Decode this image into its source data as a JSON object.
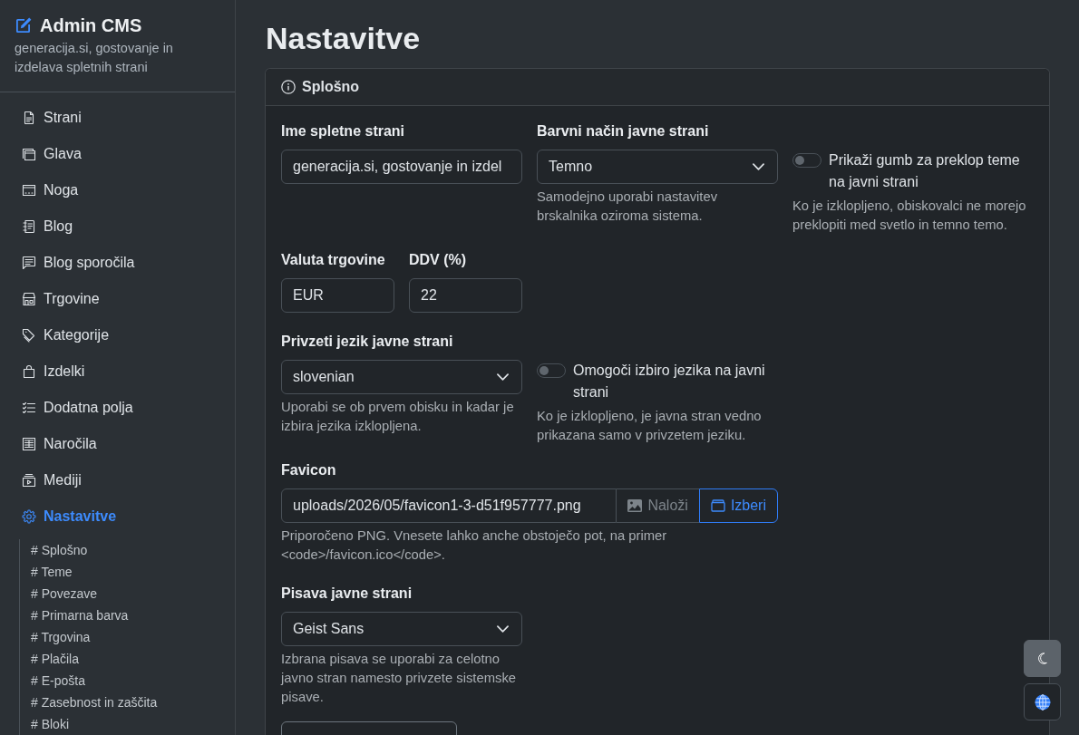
{
  "sidebar": {
    "brand": "Admin CMS",
    "tagline": "generacija.si, gostovanje in izdelava spletnih strani",
    "items": [
      {
        "label": "Strani",
        "selected": false
      },
      {
        "label": "Glava",
        "selected": false
      },
      {
        "label": "Noga",
        "selected": false
      },
      {
        "label": "Blog",
        "selected": false
      },
      {
        "label": "Blog sporočila",
        "selected": false
      },
      {
        "label": "Trgovine",
        "selected": false
      },
      {
        "label": "Kategorije",
        "selected": false
      },
      {
        "label": "Izdelki",
        "selected": false
      },
      {
        "label": "Dodatna polja",
        "selected": false
      },
      {
        "label": "Naročila",
        "selected": false
      },
      {
        "label": "Mediji",
        "selected": false
      },
      {
        "label": "Nastavitve",
        "selected": true,
        "children": [
          {
            "label": "# Splošno"
          },
          {
            "label": "# Teme"
          },
          {
            "label": "# Povezave"
          },
          {
            "label": "# Primarna barva"
          },
          {
            "label": "# Trgovina"
          },
          {
            "label": "# Plačila"
          },
          {
            "label": "# E-pošta"
          },
          {
            "label": "# Zasebnost in zaščita"
          },
          {
            "label": "# Bloki"
          }
        ]
      }
    ]
  },
  "page": {
    "title": "Nastavitve"
  },
  "card": {
    "title": "Splošno",
    "rows": [
      {
        "fields": [
          {
            "kind": "text",
            "label": "Ime spletne strani",
            "value": "generacija.si, gostovanje in izdel"
          },
          {
            "kind": "select",
            "label": "Barvni način javne strani",
            "value": "Temno",
            "help": "Samodejno uporabi nastavitev brskalnika oziroma sistema."
          },
          {
            "kind": "toggle",
            "label": "Prikaži gumb za preklop teme na javni strani",
            "on": false,
            "help": "Ko je izklopljeno, obiskovalci ne morejo preklopiti med svetlo in temno temo."
          }
        ]
      },
      {
        "fields": [
          {
            "kind": "short_text",
            "label": "Valuta trgovine",
            "value": "EUR"
          },
          {
            "kind": "short_text",
            "label": "DDV (%)",
            "value": "22"
          }
        ]
      },
      {
        "fields": [
          {
            "kind": "select",
            "label": "Privzeti jezik javne strani",
            "value": "slovenian",
            "help": "Uporabi se ob prvem obisku in kadar je izbira jezika izklopljena."
          },
          {
            "kind": "toggle",
            "label": "Omogoči izbiro jezika na javni strani",
            "on": false,
            "help": "Ko je izklopljeno, je javna stran vedno prikazana samo v privzetem jeziku."
          }
        ]
      },
      {
        "fields": [
          {
            "kind": "file",
            "label": "Favicon",
            "value": "uploads/2026/05/favicon1-3-d51f957777.png",
            "buttons": [
              {
                "label": "Naloži",
                "kind": "secondary"
              },
              {
                "label": "Izberi",
                "kind": "primary"
              }
            ],
            "help": "Priporočeno PNG. Vnesete lahko anche obstoječo pot, na primer <code>/favicon.ico</code>."
          }
        ]
      },
      {
        "fields": [
          {
            "kind": "select",
            "label": "Pisava javne strani",
            "value": "Geist Sans",
            "help": "Izbrana pisava se uporabi za celotno javno stran namesto privzete sistemske pisave."
          }
        ]
      }
    ]
  }
}
